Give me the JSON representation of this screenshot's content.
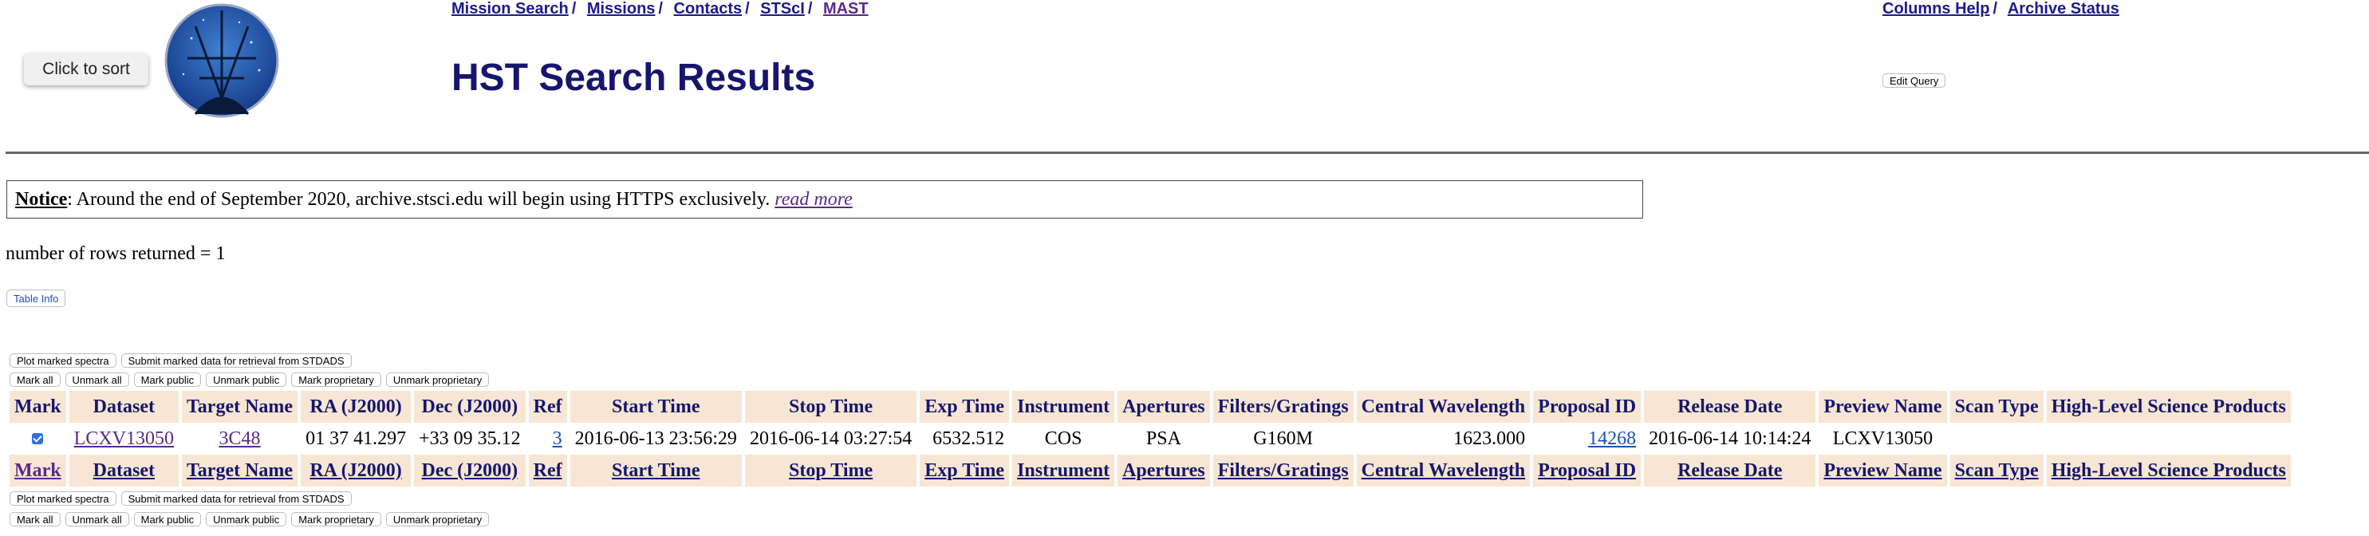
{
  "nav_left": [
    "Mission Search",
    "Missions",
    "Contacts",
    "STScI",
    "MAST"
  ],
  "nav_right": [
    "Columns Help",
    "Archive Status"
  ],
  "sort_button": "Click to sort",
  "title": "HST Search Results",
  "edit_query": "Edit Query",
  "notice": {
    "label": "Notice",
    "text": ": Around the end of September 2020, archive.stsci.edu will begin using HTTPS exclusively.",
    "link": "read more"
  },
  "rows_returned": "number of rows returned = 1",
  "table_info": "Table Info",
  "buttons_row1": [
    "Plot marked spectra",
    "Submit marked data for retrieval from STDADS"
  ],
  "buttons_row2": [
    "Mark all",
    "Unmark all",
    "Mark public",
    "Unmark public",
    "Mark proprietary",
    "Unmark proprietary"
  ],
  "columns": [
    "Mark",
    "Dataset",
    "Target Name",
    "RA (J2000)",
    "Dec (J2000)",
    "Ref",
    "Start Time",
    "Stop Time",
    "Exp Time",
    "Instrument",
    "Apertures",
    "Filters/Gratings",
    "Central Wavelength",
    "Proposal ID",
    "Release Date",
    "Preview Name",
    "Scan Type",
    "High-Level Science Products"
  ],
  "row": {
    "dataset": "LCXV13050",
    "target": "3C48",
    "ra": "01 37 41.297",
    "dec": "+33 09 35.12",
    "ref": "3",
    "start": "2016-06-13 23:56:29",
    "stop": "2016-06-14 03:27:54",
    "exp": "6532.512",
    "instrument": "COS",
    "aperture": "PSA",
    "filter": "G160M",
    "wavelength": "1623.000",
    "proposal": "14268",
    "release": "2016-06-14 10:14:24",
    "preview": "LCXV13050",
    "scan": "",
    "hlsp": ""
  }
}
